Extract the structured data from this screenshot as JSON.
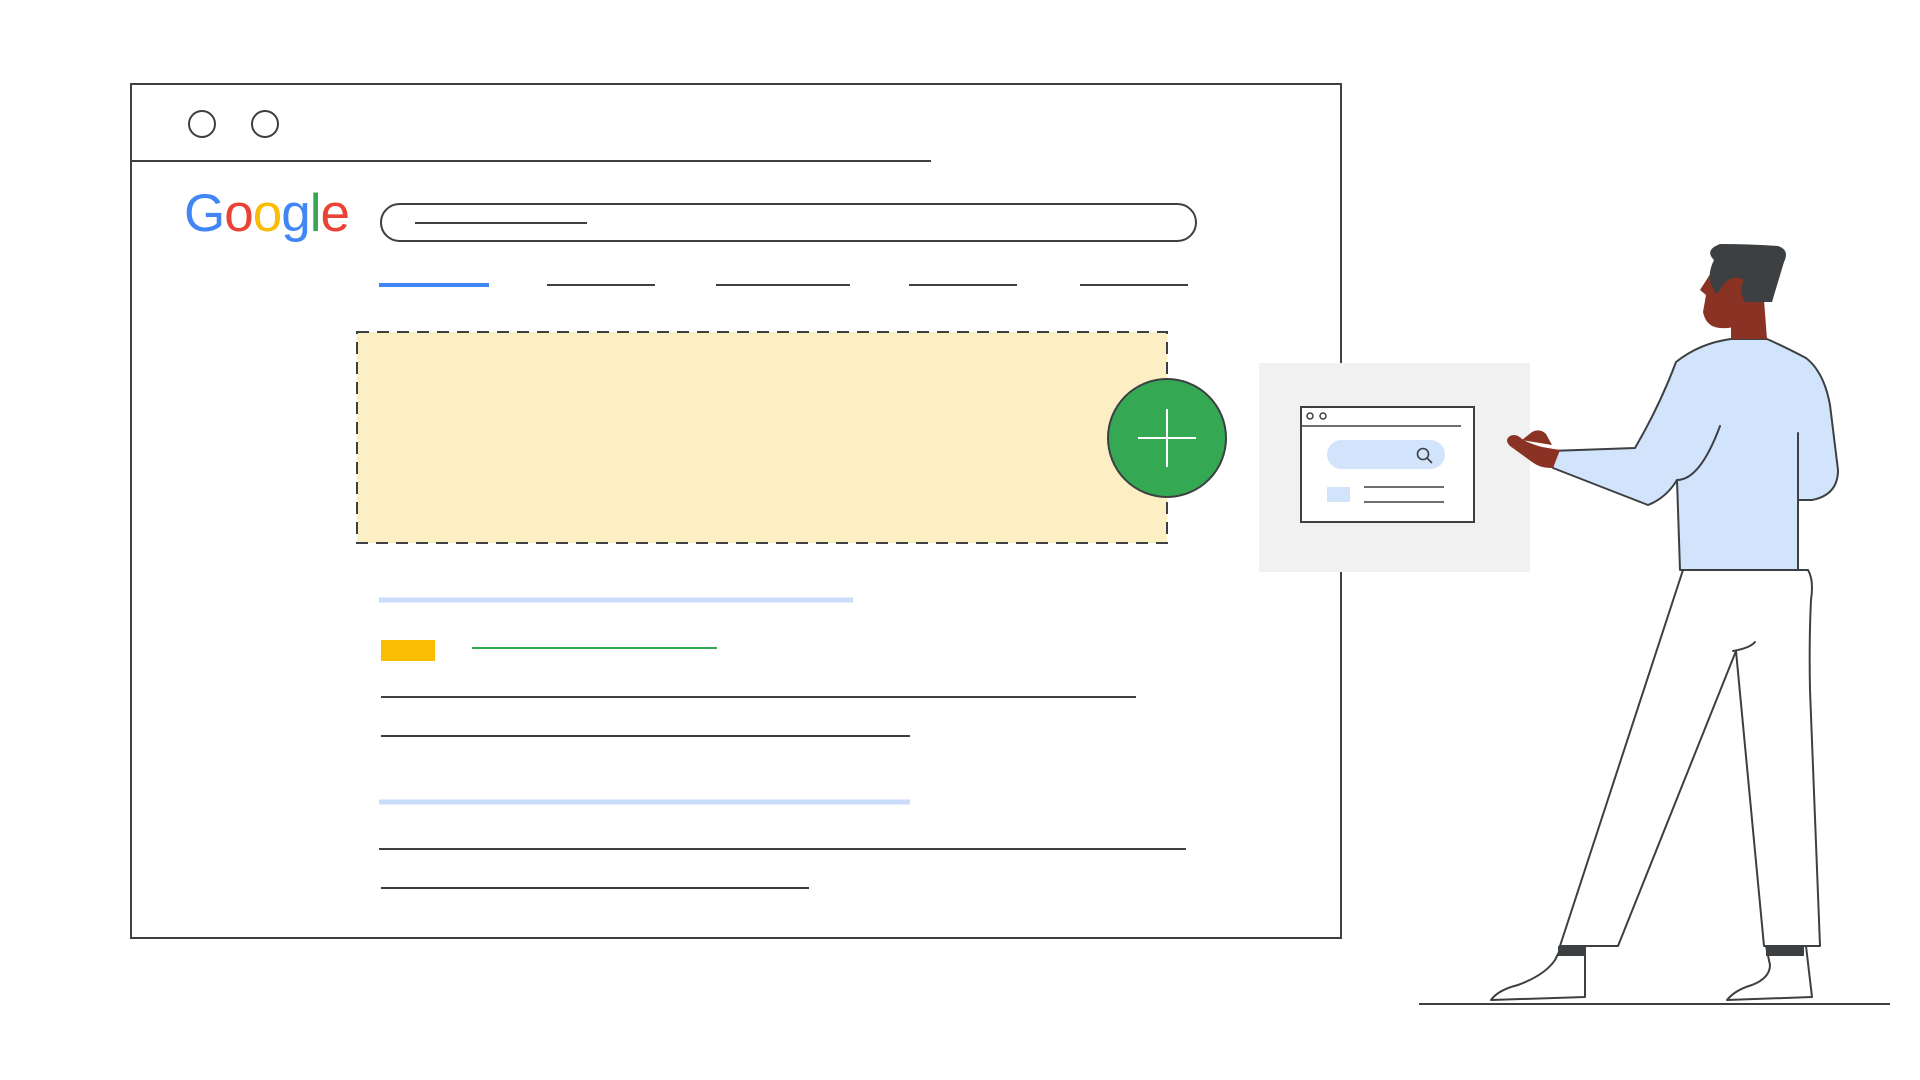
{
  "logo": {
    "letters": [
      {
        "char": "G",
        "color": "#4285F4"
      },
      {
        "char": "o",
        "color": "#EA4335"
      },
      {
        "char": "o",
        "color": "#FBBC05"
      },
      {
        "char": "g",
        "color": "#4285F4"
      },
      {
        "char": "l",
        "color": "#34A853"
      },
      {
        "char": "e",
        "color": "#EA4335"
      }
    ]
  },
  "icons": {
    "add": "plus-icon",
    "mini_search": "search-icon"
  },
  "colors": {
    "outline": "#3c4043",
    "active_tab": "#4285F4",
    "ad_placeholder_fill": "#FCEFC4",
    "add_button": "#34A853",
    "result_title": "#C9DCF9",
    "result_url": "#34A853",
    "ad_badge": "#FBBC04",
    "preview_panel": "#F1F1F1",
    "preview_search": "#D2E3FC",
    "shirt": "#D2E3FC",
    "skin": "#8A3224",
    "hair": "#3C4043"
  }
}
